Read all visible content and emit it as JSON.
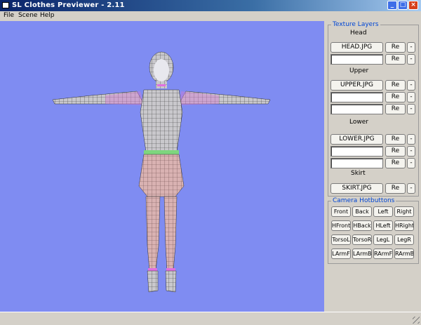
{
  "window": {
    "title": "SL Clothes Previewer - 2.11",
    "buttons": {
      "minimize": "_",
      "maximize": "□",
      "close": "×"
    }
  },
  "menu": [
    "File",
    "Scene",
    "Help"
  ],
  "viewport": {
    "background": "#7f8cf2"
  },
  "texture_layers": {
    "title": "Texture Layers",
    "head": {
      "label": "Head",
      "file": "HEAD.JPG",
      "reload": "Re",
      "remove": "-"
    },
    "upper": {
      "label": "Upper",
      "file": "UPPER.JPG",
      "reload": "Re",
      "remove": "-"
    },
    "lower": {
      "label": "Lower",
      "file": "LOWER.JPG",
      "reload": "Re",
      "remove": "-"
    },
    "skirt": {
      "label": "Skirt",
      "file": "SKIRT.JPG",
      "reload": "Re",
      "remove": "-"
    }
  },
  "camera_hotbuttons": {
    "title": "Camera Hotbuttons",
    "rows": [
      [
        "Front",
        "Back",
        "Left",
        "Right"
      ],
      [
        "HFront",
        "HBack",
        "HLeft",
        "HRight"
      ],
      [
        "TorsoL",
        "TorsoR",
        "LegL",
        "LegR"
      ],
      [
        "LArmF",
        "LArmB",
        "RArmF",
        "RArmB"
      ]
    ]
  }
}
